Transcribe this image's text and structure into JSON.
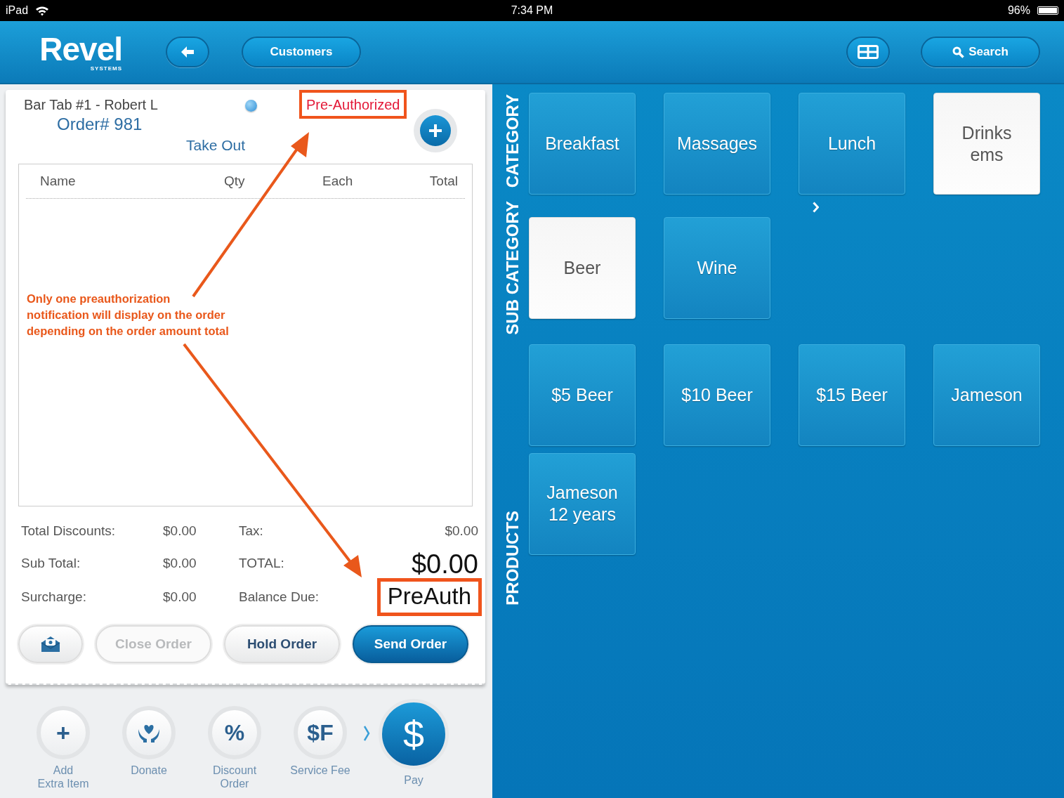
{
  "status_bar": {
    "device": "iPad",
    "time": "7:34 PM",
    "battery": "96%"
  },
  "header": {
    "logo": "Revel",
    "logo_sub": "SYSTEMS",
    "customers_button": "Customers",
    "search_button": "Search"
  },
  "order": {
    "tab_name": "Bar Tab #1 - Robert L",
    "order_number": "Order# 981",
    "status": "Pre-Authorized",
    "order_type": "Take Out",
    "columns": [
      "Name",
      "Qty",
      "Each",
      "Total"
    ],
    "totals": [
      {
        "left_label": "Total Discounts:",
        "left_value": "$0.00",
        "right_label": "Tax:",
        "right_value": "$0.00",
        "kind": "plain"
      },
      {
        "left_label": "Sub Total:",
        "left_value": "$0.00",
        "right_label": "TOTAL:",
        "right_value": "$0.00",
        "kind": "large"
      },
      {
        "left_label": "Surcharge:",
        "left_value": "$0.00",
        "right_label": "Balance Due:",
        "right_value": "PreAuth",
        "kind": "highlighted"
      }
    ],
    "buttons": [
      {
        "label": "Close Order",
        "disabled": true,
        "primary": false
      },
      {
        "label": "Hold Order",
        "disabled": false,
        "primary": false
      },
      {
        "label": "Send Order",
        "disabled": false,
        "primary": true
      }
    ]
  },
  "actions": [
    {
      "kind": "plus",
      "glyph": "+",
      "lines": [
        "Add",
        "Extra Item"
      ]
    },
    {
      "kind": "donate",
      "lines": [
        "Donate"
      ]
    },
    {
      "kind": "text",
      "glyph": "%",
      "lines": [
        "Discount",
        "Order"
      ]
    },
    {
      "kind": "text",
      "glyph": "$F",
      "lines": [
        "Service Fee"
      ]
    },
    {
      "kind": "pay",
      "glyph": "$",
      "lines": [
        "Pay"
      ]
    }
  ],
  "annotation": {
    "lines": [
      "Only one preauthorization",
      "notification will display on the order",
      "depending on the order amount total"
    ]
  },
  "menu": {
    "category_label": "CATEGORY",
    "categories": [
      {
        "label": "Breakfast",
        "selected": false
      },
      {
        "label": "Massages",
        "selected": false
      },
      {
        "label": "Lunch",
        "selected": false
      },
      {
        "label": "Drinks ems",
        "selected": true
      }
    ],
    "subcategory_label": "SUB CATEGORY",
    "subcategories": [
      {
        "label": "Beer",
        "selected": true
      },
      {
        "label": "Wine",
        "selected": false
      }
    ],
    "products_label": "PRODUCTS",
    "products": [
      {
        "label": "$5 Beer",
        "selected": false
      },
      {
        "label": "$10 Beer",
        "selected": false
      },
      {
        "label": "$15 Beer",
        "selected": false
      },
      {
        "label": "Jameson",
        "selected": false
      },
      {
        "label": "Jameson 12 years",
        "selected": false
      }
    ]
  }
}
